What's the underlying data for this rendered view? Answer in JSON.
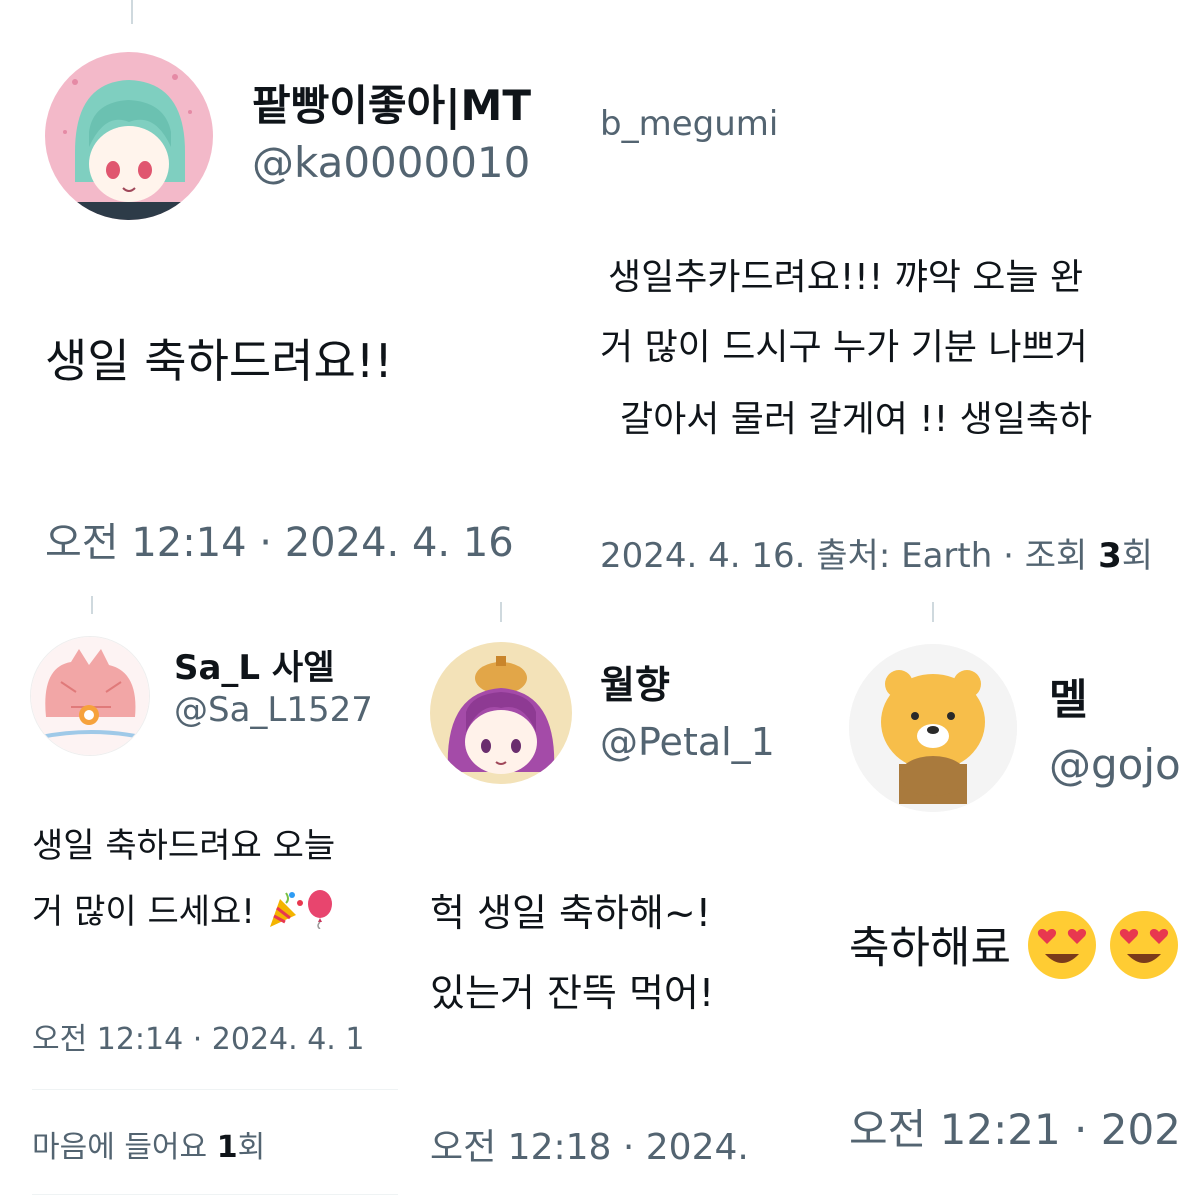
{
  "tweet1": {
    "display_name": "팥빵이좋아|MT",
    "handle": "@ka0000010",
    "text": "생일 축하드려요!!",
    "timestamp": "오전 12:14 · 2024. 4. 16"
  },
  "tweet2": {
    "handle_tail": "b_megumi",
    "line1": "생일추카드려요!!! 꺄악 오늘 완",
    "line2": "거 많이 드시구 누가 기분 나쁘거",
    "line3": "갈아서 물러 갈게여 !! 생일축하",
    "meta_prefix": "2024. 4. 16. 출처: Earth · 조회 ",
    "views_count": "3",
    "views_unit": "회"
  },
  "tweet3": {
    "display_name": "Sa_L 사엘",
    "handle": "@Sa_L1527",
    "line1": "생일 축하드려요 오늘",
    "line2": "거 많이 드세요!",
    "emoji_a": "party-popper-icon",
    "emoji_b": "balloon-icon",
    "timestamp": "오전 12:14 · 2024. 4. 1",
    "likes_prefix": "마음에 들어요 ",
    "likes_count": "1",
    "likes_unit": "회"
  },
  "tweet4": {
    "display_name": "월향",
    "handle": "@Petal_1",
    "line1": "헉 생일 축하해~!",
    "line2": "있는거 잔뜩 먹어!",
    "timestamp": "오전 12:18 · 2024."
  },
  "tweet5": {
    "display_name": "멜",
    "handle": "@gojo",
    "text": "축하해료",
    "emoji": "heart-eyes-face-icon",
    "timestamp": "오전 12:21 · 202"
  },
  "colors": {
    "text_primary": "#0f1419",
    "text_secondary": "#536471",
    "thread_line": "#cfd9de",
    "emoji_yellow": "#ffcc33",
    "heart_red": "#e8384f"
  }
}
